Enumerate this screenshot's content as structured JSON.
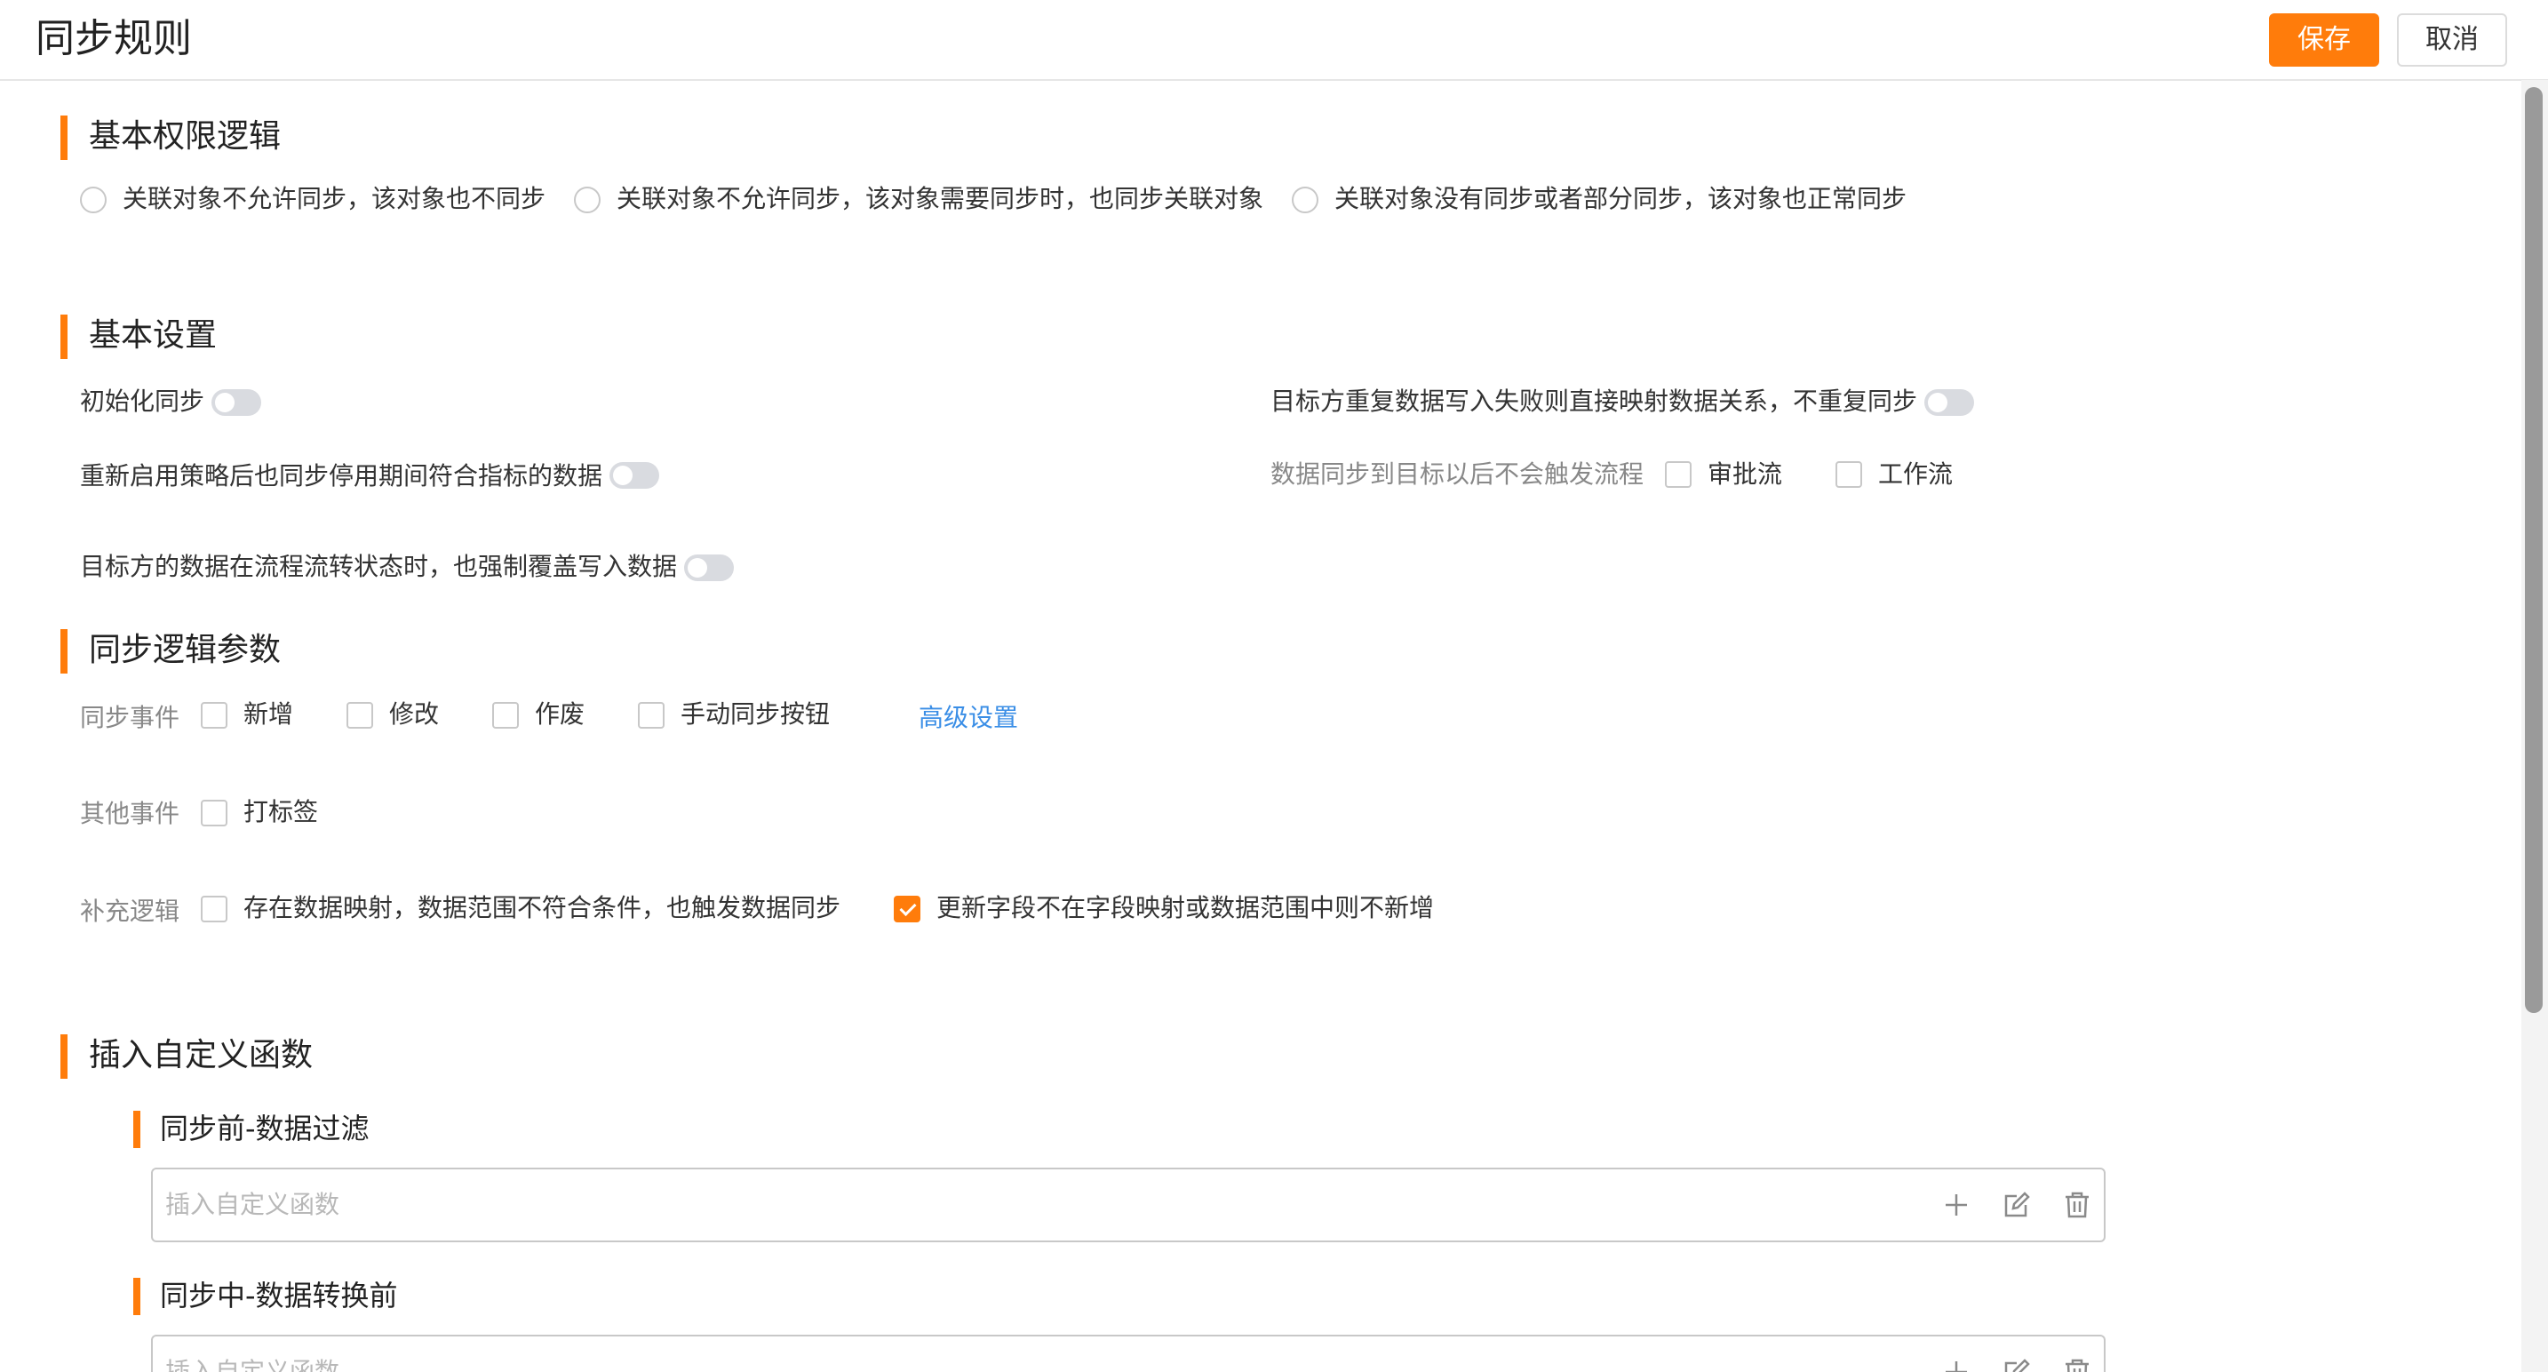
{
  "header": {
    "title": "同步规则",
    "save_label": "保存",
    "cancel_label": "取消"
  },
  "permission": {
    "title": "基本权限逻辑",
    "options": [
      "关联对象不允许同步，该对象也不同步",
      "关联对象不允许同步，该对象需要同步时，也同步关联对象",
      "关联对象没有同步或者部分同步，该对象也正常同步"
    ]
  },
  "basic": {
    "title": "基本设置",
    "init_sync": "初始化同步",
    "restart_sync": "重新启用策略后也同步停用期间符合指标的数据",
    "force_overwrite": "目标方的数据在流程流转状态时，也强制覆盖写入数据",
    "dup_map": "目标方重复数据写入失败则直接映射数据关系，不重复同步",
    "no_trigger": "数据同步到目标以后不会触发流程",
    "approval_flow": "审批流",
    "work_flow": "工作流"
  },
  "logic": {
    "title": "同步逻辑参数",
    "sync_events_label": "同步事件",
    "sync_events": [
      "新增",
      "修改",
      "作废",
      "手动同步按钮"
    ],
    "advanced": "高级设置",
    "other_events_label": "其他事件",
    "other_events": [
      "打标签"
    ],
    "supplement_label": "补充逻辑",
    "supplement": [
      "存在数据映射，数据范围不符合条件，也触发数据同步",
      "更新字段不在字段映射或数据范围中则不新增"
    ],
    "supplement_checked": [
      false,
      true
    ]
  },
  "functions": {
    "title": "插入自定义函数",
    "pre_filter": "同步前-数据过滤",
    "mid_transform": "同步中-数据转换前",
    "placeholder": "插入自定义函数"
  },
  "colors": {
    "accent": "#ff7c0b",
    "link": "#3a8ee6"
  }
}
